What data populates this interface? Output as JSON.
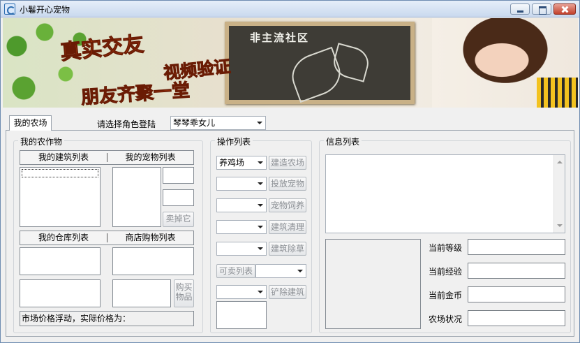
{
  "window": {
    "title": "小鬈开心宠物"
  },
  "banner": {
    "line1": "真实交友",
    "line2": "视频验证",
    "line3": "朋友齐聚一堂",
    "board_text": "非主流社区"
  },
  "tabs": [
    {
      "label": "我的农场"
    }
  ],
  "role": {
    "label": "请选择角色登陆",
    "selected": "琴琴乖女儿"
  },
  "farm_group": {
    "title": "我的农作物",
    "list_header_1": "我的建筑列表",
    "list_header_2": "我的宠物列表",
    "sell_button": "卖掉它",
    "list_header_3": "我的仓库列表",
    "list_header_4": "商店购物列表",
    "buy_button": "购买物品",
    "status": "市场价格浮动，实际价格为："
  },
  "ops_group": {
    "title": "操作列表",
    "rows": [
      {
        "combo": "养鸡场",
        "button": "建造农场"
      },
      {
        "combo": "",
        "button": "投放宠物"
      },
      {
        "combo": "",
        "button": "宠物饲养"
      },
      {
        "combo": "",
        "button": "建筑清理"
      },
      {
        "combo": "",
        "button": "建筑除草"
      }
    ],
    "sellable_button": "可卖列表",
    "sellable_combo": "",
    "remove_combo": "",
    "remove_button": "铲除建筑"
  },
  "info_group": {
    "title": "信息列表",
    "fields": [
      {
        "label": "当前等级",
        "value": ""
      },
      {
        "label": "当前经验",
        "value": ""
      },
      {
        "label": "当前金币",
        "value": ""
      },
      {
        "label": "农场状况",
        "value": ""
      }
    ]
  }
}
